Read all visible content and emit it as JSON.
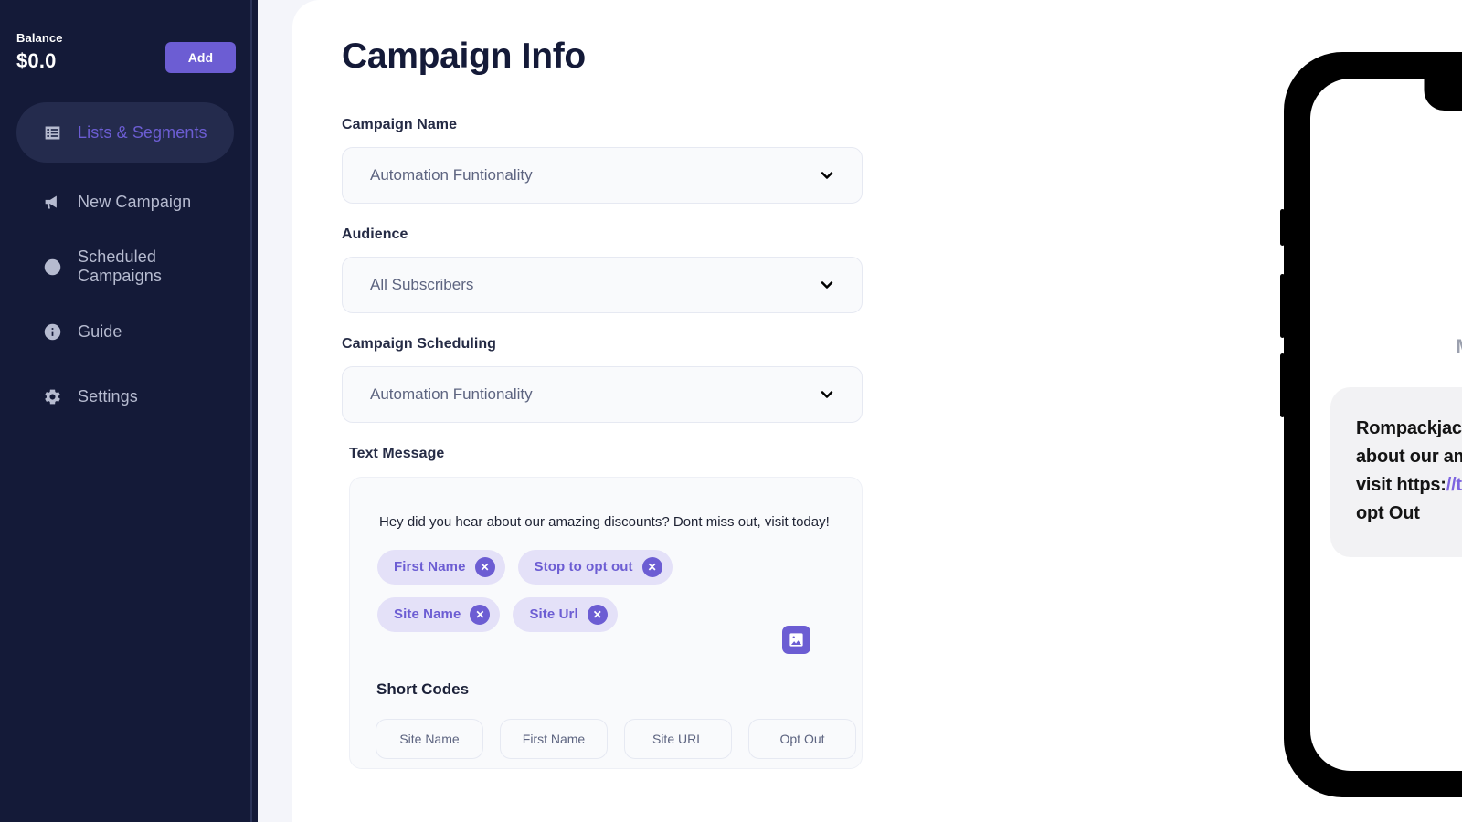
{
  "sidebar": {
    "balance_label": "Balance",
    "balance_value": "$0.0",
    "add_label": "Add",
    "items": [
      {
        "label": "Lists & Segments",
        "icon": "list-icon",
        "active": true
      },
      {
        "label": "New Campaign",
        "icon": "megaphone-icon",
        "active": false
      },
      {
        "label": "Scheduled Campaigns",
        "icon": "clock-icon",
        "active": false
      },
      {
        "label": "Guide",
        "icon": "info-circle-icon",
        "active": false
      },
      {
        "label": "Settings",
        "icon": "gear-icon",
        "active": false
      }
    ]
  },
  "main": {
    "page_title": "Campaign Info",
    "fields": [
      {
        "label": "Campaign Name",
        "value": "Automation Funtionality"
      },
      {
        "label": "Audience",
        "value": "All Subscribers"
      },
      {
        "label": "Campaign Scheduling",
        "value": "Automation Funtionality"
      }
    ],
    "text_message": {
      "label": "Text Message",
      "body": "Hey did you hear about our amazing discounts? Dont miss out, visit today!",
      "chips": [
        {
          "label": "First Name",
          "remove": "✕"
        },
        {
          "label": "Stop to opt out",
          "remove": "✕"
        },
        {
          "label": "Site Name",
          "remove": "✕"
        },
        {
          "label": "Site Url",
          "remove": "✕"
        }
      ],
      "image_icon": "image-icon"
    },
    "short_codes": {
      "title": "Short Codes",
      "buttons": [
        "Site Name",
        "First Name",
        "Site URL",
        "Opt Out"
      ]
    }
  },
  "preview": {
    "title": "Message Preview",
    "message_prefix": "Rompackjack: Hey Pierce, did you hear about our amazing discounts? Don’t miss visit https:",
    "message_link": "//testyipsms.com",
    "message_suffix": " today! STOP to opt Out"
  },
  "colors": {
    "sidebar_bg": "#141A38",
    "accent": "#6C5DD3",
    "accent_soft": "#E4E1F8",
    "active_nav_bg": "#242B4D",
    "field_bg": "#F9FAFC",
    "bubble_bg": "#F2F2F4",
    "link": "#7D64E0"
  }
}
